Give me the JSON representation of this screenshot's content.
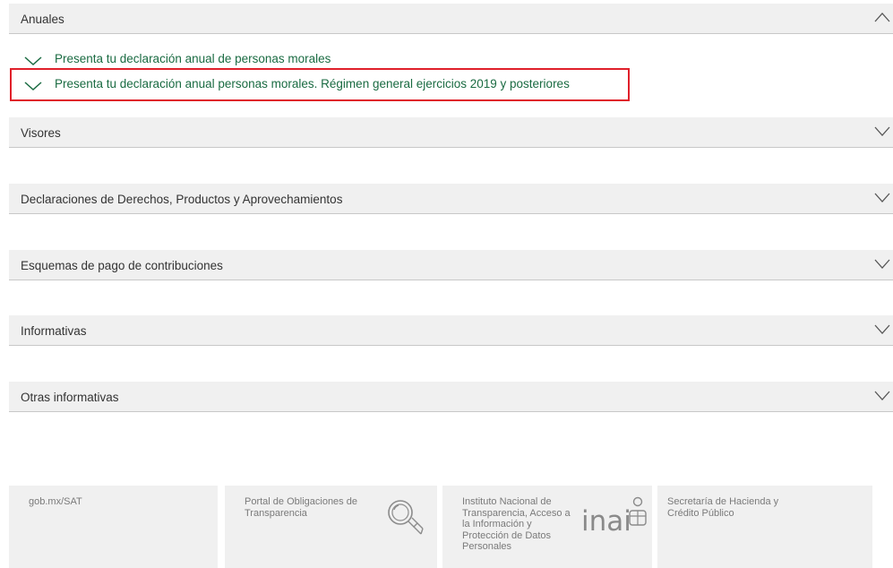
{
  "sections": [
    {
      "title": "Anuales",
      "expanded": true,
      "items": [
        {
          "label": "Presenta tu declaración anual de personas morales"
        },
        {
          "label": "Presenta tu declaración anual personas morales. Régimen general ejercicios 2019 y posteriores",
          "highlighted": true
        }
      ]
    },
    {
      "title": "Visores",
      "expanded": false
    },
    {
      "title": "Declaraciones de Derechos, Productos y Aprovechamientos",
      "expanded": false
    },
    {
      "title": "Esquemas de pago de contribuciones",
      "expanded": false
    },
    {
      "title": "Informativas",
      "expanded": false
    },
    {
      "title": "Otras informativas",
      "expanded": false
    }
  ],
  "footer": {
    "cards": [
      {
        "label": "gob.mx/SAT"
      },
      {
        "label_line1": "Portal de Obligaciones de",
        "label_line2": "Transparencia",
        "icon": "magnifier-icon"
      },
      {
        "label_line1": "Instituto Nacional de",
        "label_line2": "Transparencia, Acceso a",
        "label_line3": "la Información y",
        "label_line4": "Protección de Datos",
        "label_line5": "Personales",
        "logo_text": "inai",
        "icon": "inai-logo-icon"
      },
      {
        "label_line1": "Secretaría de Hacienda y",
        "label_line2": "Crédito Público"
      }
    ]
  },
  "colors": {
    "header_bg": "#f0f0f0",
    "link_green": "#1a6b42",
    "highlight_red": "#e0202a",
    "footer_text": "#7a7a7a"
  }
}
